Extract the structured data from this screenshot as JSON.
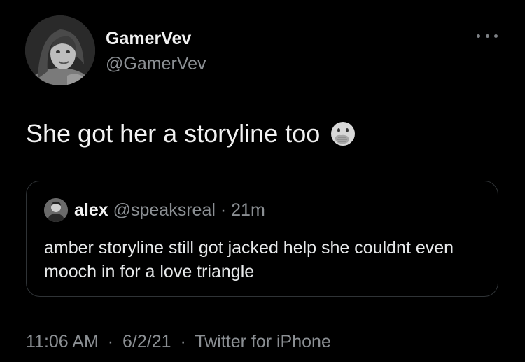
{
  "tweet": {
    "author": {
      "display_name": "GamerVev",
      "handle": "@GamerVev",
      "avatar_icon": "profile-photo"
    },
    "text": "She got her a storyline too",
    "emoji": "face-with-hand-over-mouth-icon",
    "more_icon": "more-options-icon",
    "quote": {
      "display_name": "alex",
      "handle": "@speaksreal",
      "separator": "·",
      "time_ago": "21m",
      "text": "amber storyline still got jacked help she couldnt even mooch in for a love triangle"
    },
    "meta": {
      "time": "11:06 AM",
      "separator1": "·",
      "date": "6/2/21",
      "separator2": "·",
      "source": "Twitter for iPhone"
    }
  },
  "colors": {
    "background": "#000000",
    "primary_text": "#f2f2f2",
    "secondary_text": "#8b8f93",
    "border": "#2f3336"
  }
}
